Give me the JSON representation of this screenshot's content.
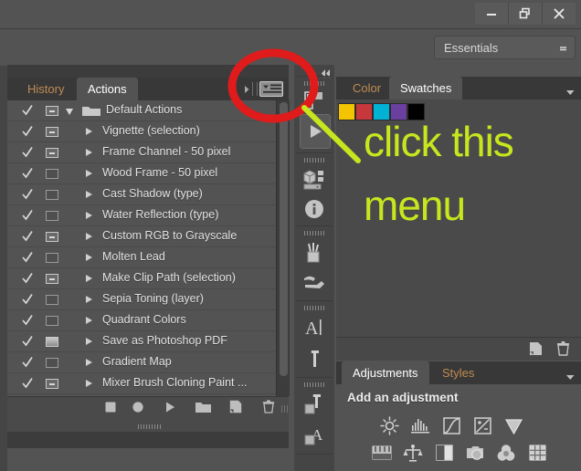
{
  "window": {
    "controls": [
      {
        "name": "minimize",
        "glyph": "minimize-icon"
      },
      {
        "name": "restore",
        "glyph": "restore-icon"
      },
      {
        "name": "close",
        "glyph": "close-icon"
      }
    ]
  },
  "options_bar": {
    "workspace_label": "Essentials",
    "workspace_caret": "chevron-down-icon"
  },
  "actions_panel": {
    "tabs": [
      {
        "label": "History",
        "active": false
      },
      {
        "label": "Actions",
        "active": true
      }
    ],
    "tab_overflow_icon": "chevron-right-icon",
    "panel_menu_icon": "panel-menu-icon",
    "rows": [
      {
        "label": "Default Actions",
        "checked": true,
        "dialog": "dash",
        "kind": "folder",
        "expanded": true
      },
      {
        "label": "Vignette (selection)",
        "checked": true,
        "dialog": "dash",
        "kind": "action",
        "expanded": false
      },
      {
        "label": "Frame Channel - 50 pixel",
        "checked": true,
        "dialog": "dash",
        "kind": "action",
        "expanded": false
      },
      {
        "label": "Wood Frame - 50 pixel",
        "checked": true,
        "dialog": "empty",
        "kind": "action",
        "expanded": false
      },
      {
        "label": "Cast Shadow (type)",
        "checked": true,
        "dialog": "empty",
        "kind": "action",
        "expanded": false
      },
      {
        "label": "Water Reflection (type)",
        "checked": true,
        "dialog": "empty",
        "kind": "action",
        "expanded": false
      },
      {
        "label": "Custom RGB to Grayscale",
        "checked": true,
        "dialog": "dash",
        "kind": "action",
        "expanded": false
      },
      {
        "label": "Molten Lead",
        "checked": true,
        "dialog": "empty",
        "kind": "action",
        "expanded": false
      },
      {
        "label": "Make Clip Path (selection)",
        "checked": true,
        "dialog": "dash",
        "kind": "action",
        "expanded": false
      },
      {
        "label": "Sepia Toning (layer)",
        "checked": true,
        "dialog": "empty",
        "kind": "action",
        "expanded": false
      },
      {
        "label": "Quadrant Colors",
        "checked": true,
        "dialog": "empty",
        "kind": "action",
        "expanded": false
      },
      {
        "label": "Save as Photoshop PDF",
        "checked": true,
        "dialog": "filled",
        "kind": "action",
        "expanded": false
      },
      {
        "label": "Gradient Map",
        "checked": true,
        "dialog": "empty",
        "kind": "action",
        "expanded": false
      },
      {
        "label": "Mixer Brush Cloning Paint ...",
        "checked": true,
        "dialog": "dash",
        "kind": "action",
        "expanded": false
      }
    ],
    "footer_buttons": [
      {
        "name": "stop-button",
        "icon": "stop-icon"
      },
      {
        "name": "record-button",
        "icon": "record-icon"
      },
      {
        "name": "play-button",
        "icon": "play-icon"
      },
      {
        "name": "new-set-button",
        "icon": "folder-icon"
      },
      {
        "name": "new-action-button",
        "icon": "new-page-icon"
      },
      {
        "name": "delete-button",
        "icon": "trash-icon"
      }
    ]
  },
  "tool_column": {
    "items": [
      {
        "name": "grip-1",
        "icon": "grip-icon"
      },
      {
        "name": "tool-mini-bridge",
        "icon": "mini-bridge-icon"
      },
      {
        "name": "play-large-button",
        "icon": "play-icon"
      },
      {
        "name": "grip-2",
        "icon": "grip-icon"
      },
      {
        "name": "tool-3d",
        "icon": "cube-icon"
      },
      {
        "name": "tool-info",
        "icon": "info-icon"
      },
      {
        "name": "grip-3",
        "icon": "grip-icon"
      },
      {
        "name": "tool-brush-presets",
        "icon": "brushes-icon"
      },
      {
        "name": "tool-tool-presets",
        "icon": "tool-preset-icon"
      },
      {
        "name": "grip-4",
        "icon": "grip-icon"
      },
      {
        "name": "tool-character",
        "icon": "character-A-icon"
      },
      {
        "name": "tool-paragraph",
        "icon": "pilcrow-icon"
      },
      {
        "name": "grip-5",
        "icon": "grip-icon"
      },
      {
        "name": "tool-paragraph-styles",
        "icon": "paragraph-styles-icon"
      },
      {
        "name": "tool-character-styles",
        "icon": "character-styles-icon"
      }
    ],
    "collapse_icon": "collapse-panel-icon"
  },
  "color_panel": {
    "tabs": [
      {
        "label": "Color",
        "active": false
      },
      {
        "label": "Swatches",
        "active": true
      }
    ],
    "menu_icon": "chevron-down-icon",
    "swatches": [
      "#f3c400",
      "#c8373b",
      "#00b3d4",
      "#6b3fa0",
      "#000000"
    ],
    "footer_buttons": [
      {
        "name": "new-swatch-button",
        "icon": "new-page-icon"
      },
      {
        "name": "delete-swatch-button",
        "icon": "trash-icon"
      }
    ]
  },
  "adjustments_panel": {
    "tabs": [
      {
        "label": "Adjustments",
        "active": true
      },
      {
        "label": "Styles",
        "active": false
      }
    ],
    "menu_icon": "chevron-down-icon",
    "heading": "Add an adjustment",
    "row1": [
      {
        "name": "brightness-contrast",
        "icon": "sun-icon"
      },
      {
        "name": "levels",
        "icon": "levels-icon"
      },
      {
        "name": "curves",
        "icon": "curves-icon"
      },
      {
        "name": "exposure",
        "icon": "exposure-icon"
      },
      {
        "name": "vibrance",
        "icon": "triangle-down-icon"
      }
    ],
    "row2": [
      {
        "name": "hue-saturation",
        "icon": "hue-sat-icon"
      },
      {
        "name": "color-balance",
        "icon": "balance-icon"
      },
      {
        "name": "black-white",
        "icon": "half-square-icon"
      },
      {
        "name": "photo-filter",
        "icon": "camera-icon"
      },
      {
        "name": "channel-mixer",
        "icon": "venn-icon"
      },
      {
        "name": "color-lookup",
        "icon": "grid-icon"
      }
    ]
  },
  "annotation": {
    "line1": "click this",
    "line2": "menu",
    "color": "#c8e61e",
    "highlight_circle_color": "#e01b1b",
    "pointer_line": "arrow-line"
  }
}
